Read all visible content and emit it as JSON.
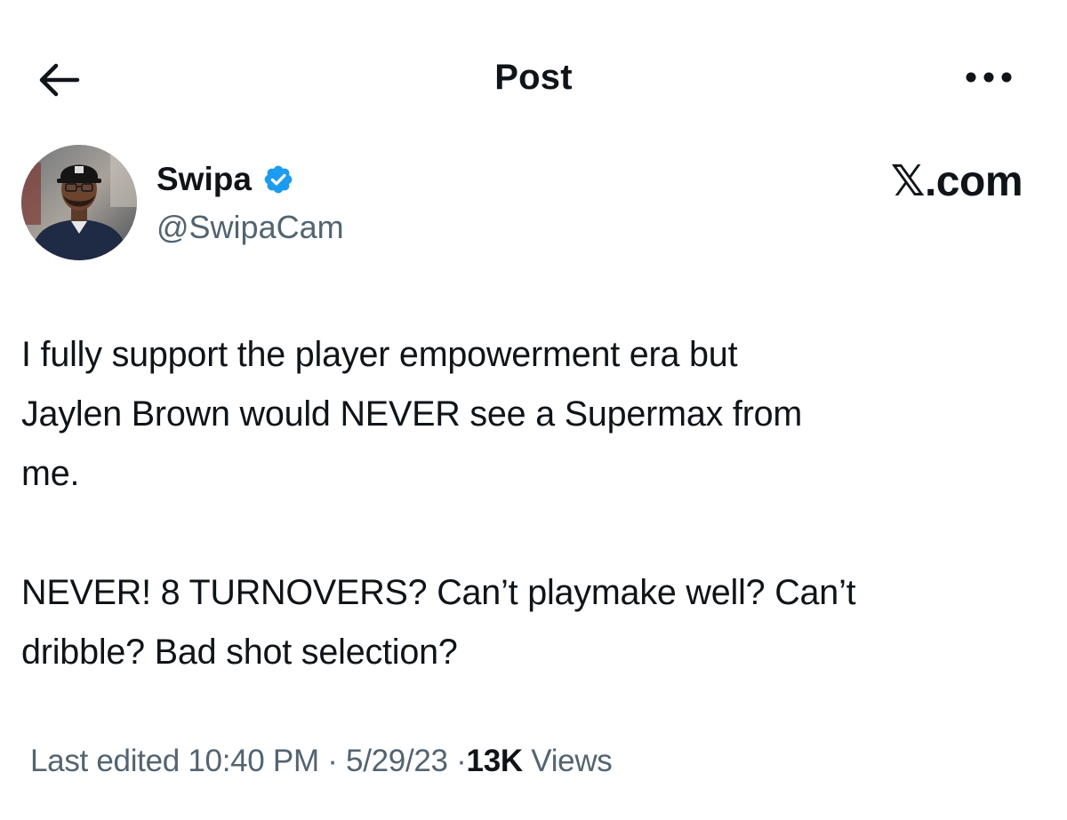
{
  "header": {
    "back_icon": "arrow-left-icon",
    "title": "Post",
    "more_icon": "more-horizontal-icon"
  },
  "author": {
    "display_name": "Swipa",
    "verified_icon": "verified-badge-icon",
    "verified_color": "#1d9bf0",
    "handle": "@SwipaCam"
  },
  "brand": {
    "text": "𝕏.com"
  },
  "post": {
    "paragraph_1": "I fully support the player empowerment era but\nJaylen Brown would NEVER see a Supermax from\nme.",
    "paragraph_2": "NEVER! 8 TURNOVERS? Can’t playmake well? Can’t\ndribble? Bad shot selection?"
  },
  "meta": {
    "prefix": "Last edited",
    "time": "10:40 PM",
    "separator": "·",
    "date": "5/29/23",
    "views_count": "13K",
    "views_label": "Views"
  },
  "colors": {
    "text_primary": "#0f1419",
    "text_secondary": "#536471",
    "background": "#ffffff"
  }
}
